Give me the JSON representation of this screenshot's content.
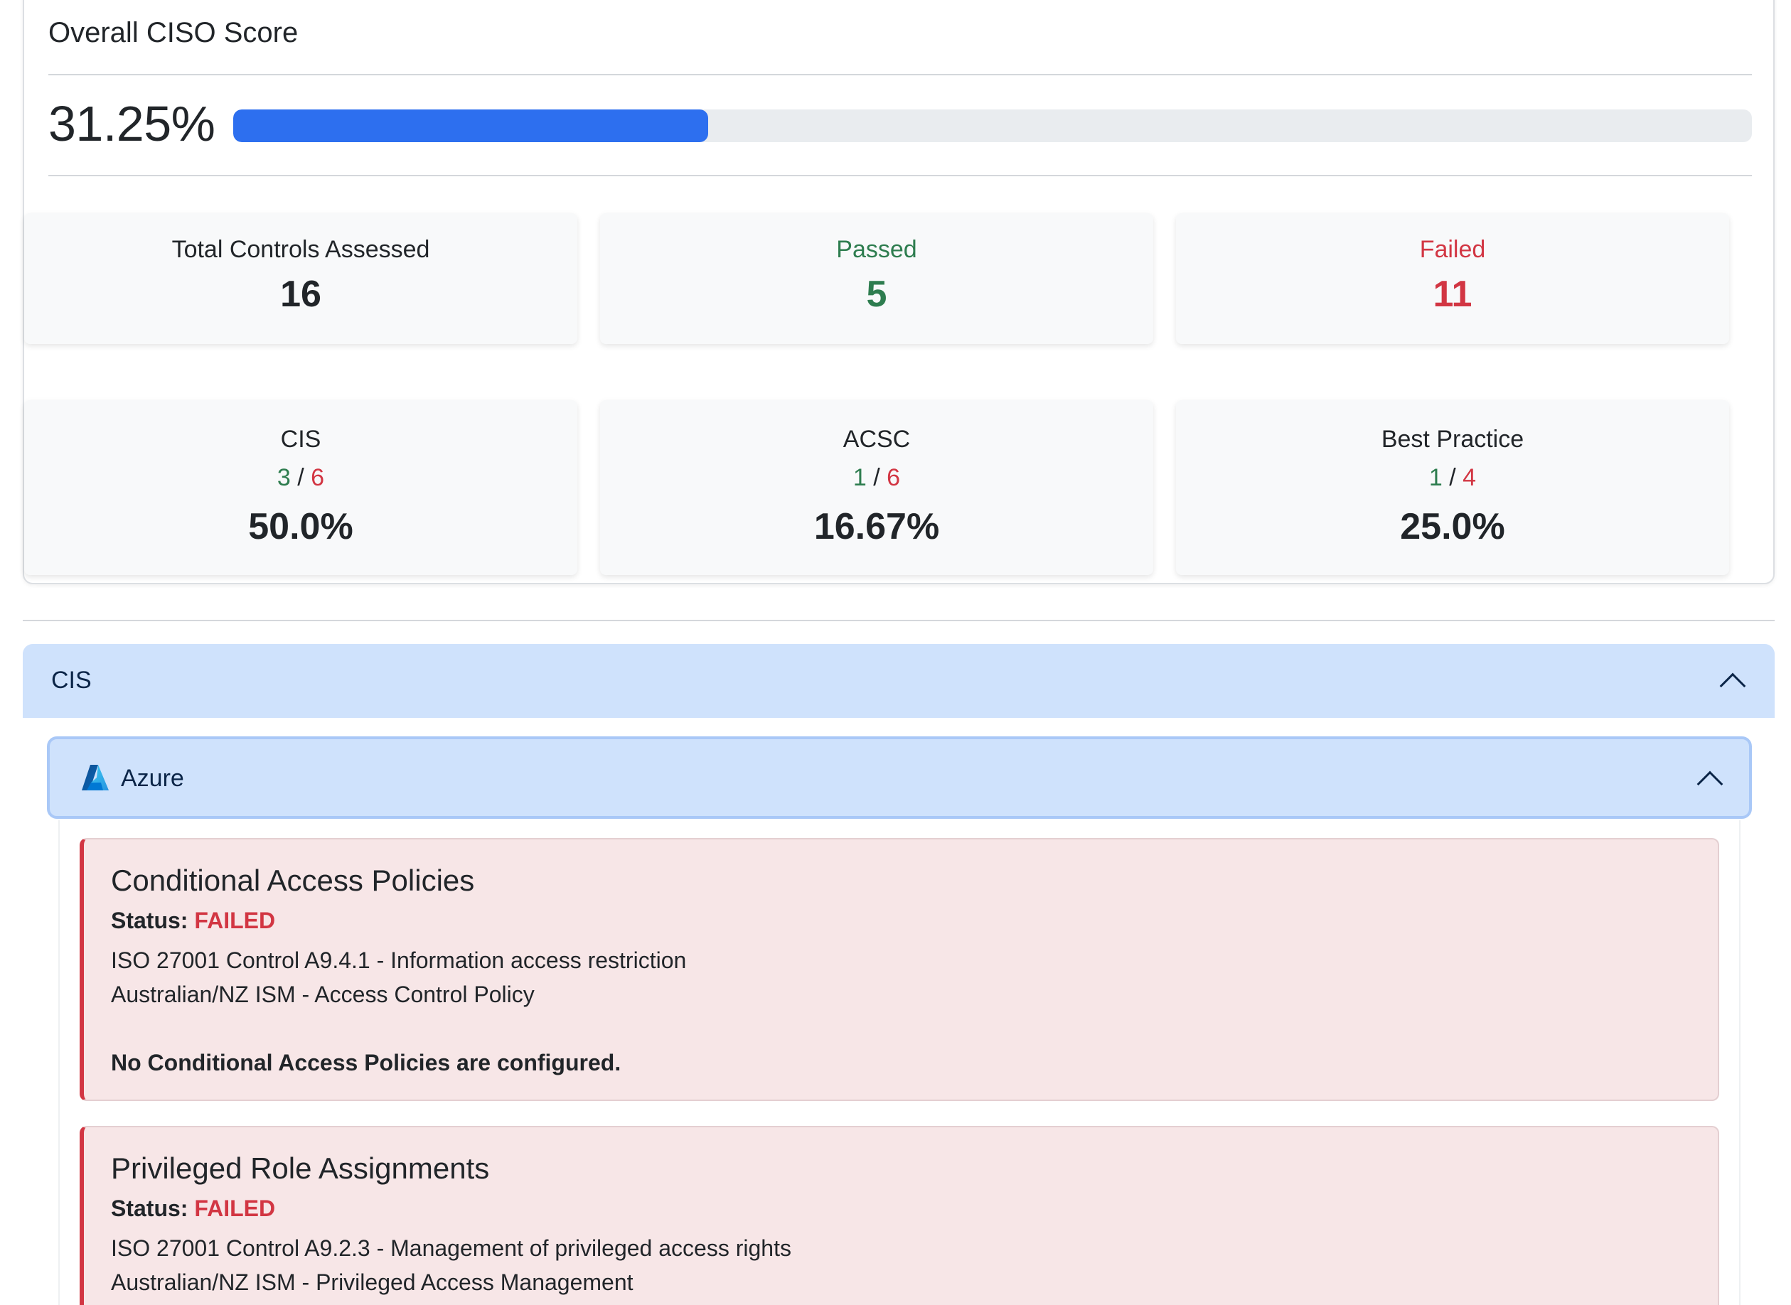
{
  "score": {
    "title": "Overall CISO Score",
    "value": "31.25%",
    "progress_percent": 31.25,
    "progress_color": "#2d6fef"
  },
  "summary": {
    "total": {
      "label": "Total Controls Assessed",
      "value": "16"
    },
    "passed": {
      "label": "Passed",
      "value": "5"
    },
    "failed": {
      "label": "Failed",
      "value": "11"
    }
  },
  "frameworks": [
    {
      "name": "CIS",
      "passed": "3",
      "total": "6",
      "percent": "50.0%"
    },
    {
      "name": "ACSC",
      "passed": "1",
      "total": "6",
      "percent": "16.67%"
    },
    {
      "name": "Best Practice",
      "passed": "1",
      "total": "4",
      "percent": "25.0%"
    }
  ],
  "colors": {
    "pass": "#2e7d4f",
    "fail": "#d23643",
    "accordion": "#cfe2fc"
  },
  "accordion": {
    "section_label": "CIS",
    "provider_label": "Azure",
    "provider_icon": "azure-logo-icon",
    "toggle_icon": "chevron-up-icon"
  },
  "controls": [
    {
      "title": "Conditional Access Policies",
      "status_label": "Status:",
      "status": "FAILED",
      "lines": [
        "ISO 27001 Control A9.4.1 - Information access restriction",
        "Australian/NZ ISM - Access Control Policy"
      ],
      "finding": "No Conditional Access Policies are configured."
    },
    {
      "title": "Privileged Role Assignments",
      "status_label": "Status:",
      "status": "FAILED",
      "lines": [
        "ISO 27001 Control A9.2.3 - Management of privileged access rights",
        "Australian/NZ ISM - Privileged Access Management"
      ]
    }
  ]
}
